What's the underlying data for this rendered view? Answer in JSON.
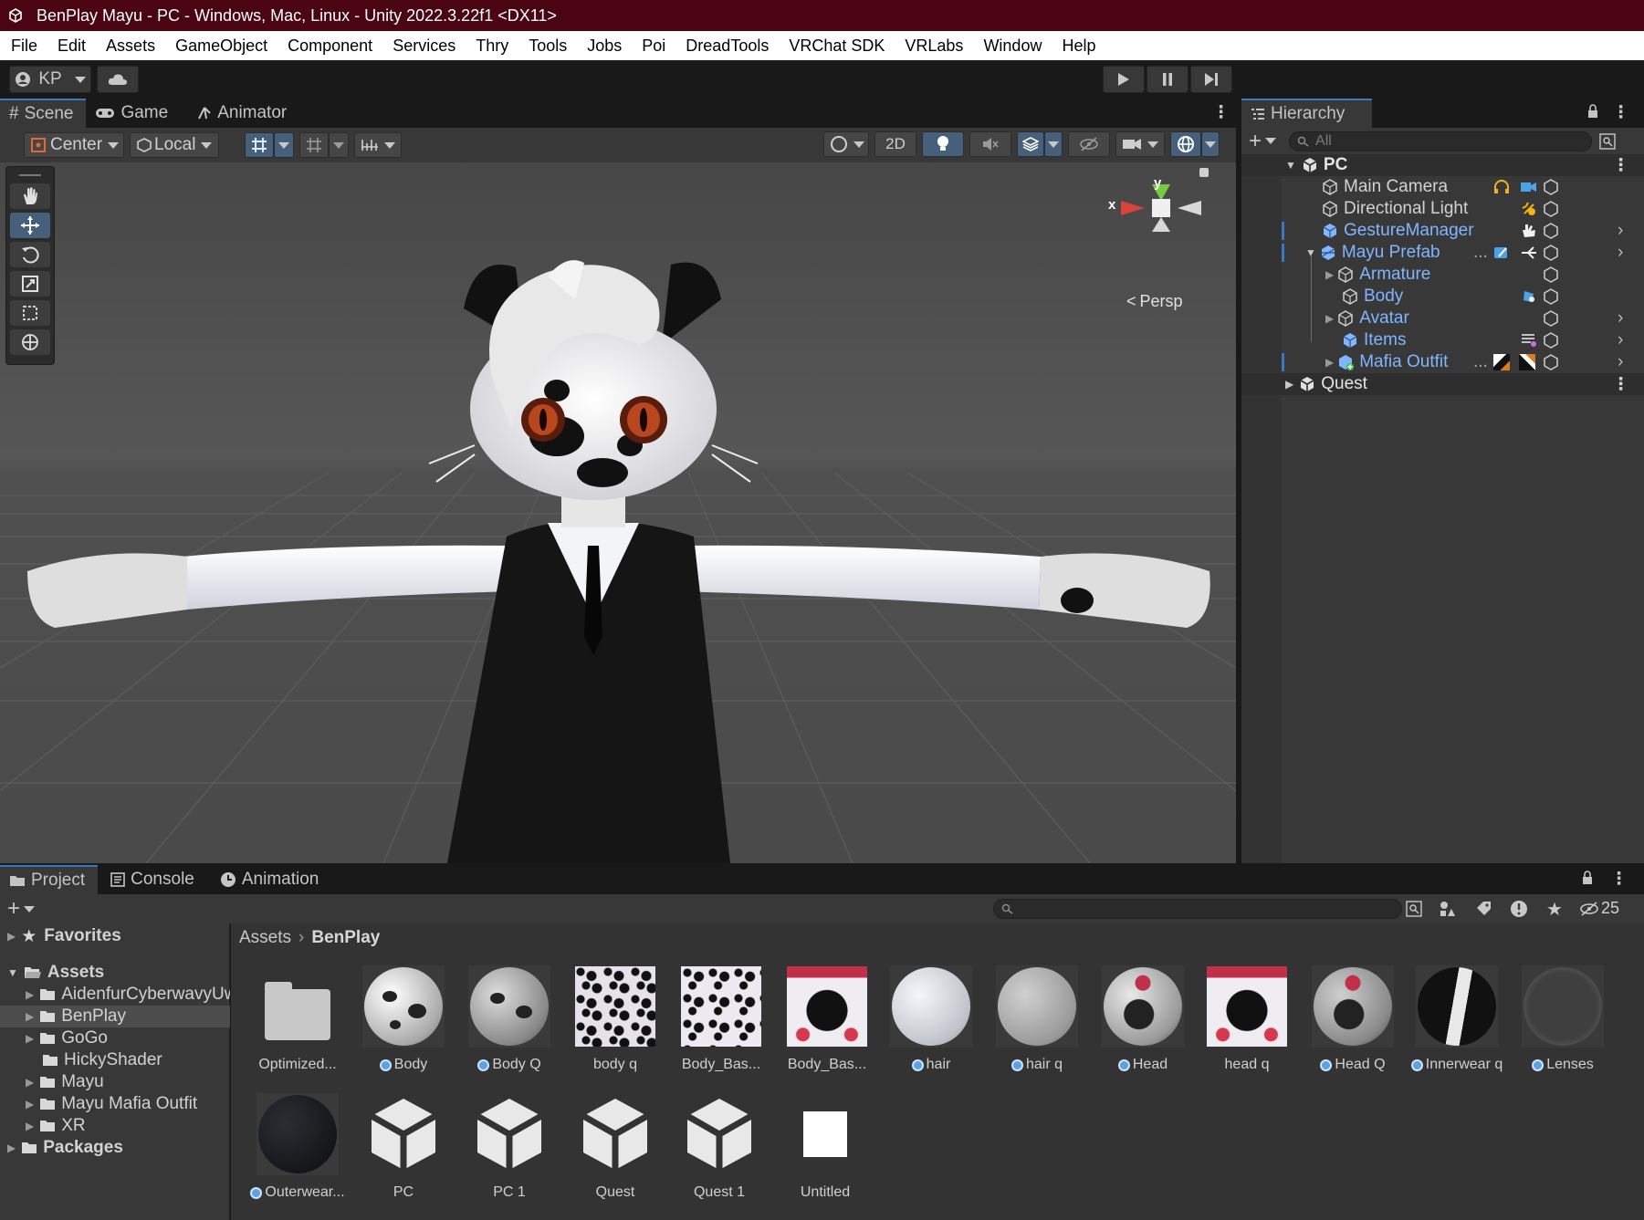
{
  "window": {
    "title": "BenPlay Mayu - PC - Windows, Mac, Linux - Unity 2022.3.22f1 <DX11>"
  },
  "menu": [
    "File",
    "Edit",
    "Assets",
    "GameObject",
    "Component",
    "Services",
    "Thry",
    "Tools",
    "Jobs",
    "Poi",
    "DreadTools",
    "VRChat SDK",
    "VRLabs",
    "Window",
    "Help"
  ],
  "toolbar": {
    "account": "KP",
    "play_icon": "play-icon",
    "pause_icon": "pause-icon",
    "step_icon": "step-icon"
  },
  "scene_tabs": [
    "Scene",
    "Game",
    "Animator"
  ],
  "scene_toolbar": {
    "pivot": "Center",
    "space": "Local",
    "mode_2d": "2D"
  },
  "gizmo": {
    "y": "y",
    "x": "x",
    "persp": "Persp"
  },
  "hierarchy": {
    "tab": "Hierarchy",
    "search_placeholder": "All",
    "rows": [
      {
        "label": "PC"
      },
      {
        "label": "Main Camera"
      },
      {
        "label": "Directional Light"
      },
      {
        "label": "GestureManager"
      },
      {
        "label": "Mayu Prefab",
        "ellipsis": "..."
      },
      {
        "label": "Armature"
      },
      {
        "label": "Body"
      },
      {
        "label": "Avatar"
      },
      {
        "label": "Items"
      },
      {
        "label": "Mafia Outfit",
        "ellipsis": "..."
      },
      {
        "label": "Quest"
      }
    ]
  },
  "bottom_tabs": [
    "Project",
    "Console",
    "Animation"
  ],
  "project": {
    "hidden_count": "25",
    "tree": [
      {
        "label": "Favorites"
      },
      {
        "label": "Assets"
      },
      {
        "label": "AidenfurCyberwavyUwU"
      },
      {
        "label": "BenPlay"
      },
      {
        "label": "GoGo"
      },
      {
        "label": "HickyShader"
      },
      {
        "label": "Mayu"
      },
      {
        "label": "Mayu Mafia Outfit"
      },
      {
        "label": "XR"
      },
      {
        "label": "Packages"
      }
    ],
    "breadcrumb": [
      "Assets",
      "BenPlay"
    ],
    "assets": [
      {
        "label": "Optimized..."
      },
      {
        "label": "Body"
      },
      {
        "label": "Body Q"
      },
      {
        "label": "body q"
      },
      {
        "label": "Body_Bas..."
      },
      {
        "label": "Body_Bas..."
      },
      {
        "label": "hair"
      },
      {
        "label": "hair q"
      },
      {
        "label": "Head"
      },
      {
        "label": "head q"
      },
      {
        "label": "Head Q"
      },
      {
        "label": "Innerwear q"
      },
      {
        "label": "Lenses"
      },
      {
        "label": "Outerwear..."
      },
      {
        "label": "PC"
      },
      {
        "label": "PC 1"
      },
      {
        "label": "Quest"
      },
      {
        "label": "Quest 1"
      },
      {
        "label": "Untitled"
      }
    ]
  },
  "colors": {
    "titlebar": "#4a0412",
    "accent": "#3a79bb",
    "prefab_blue": "#7fb6ff"
  }
}
